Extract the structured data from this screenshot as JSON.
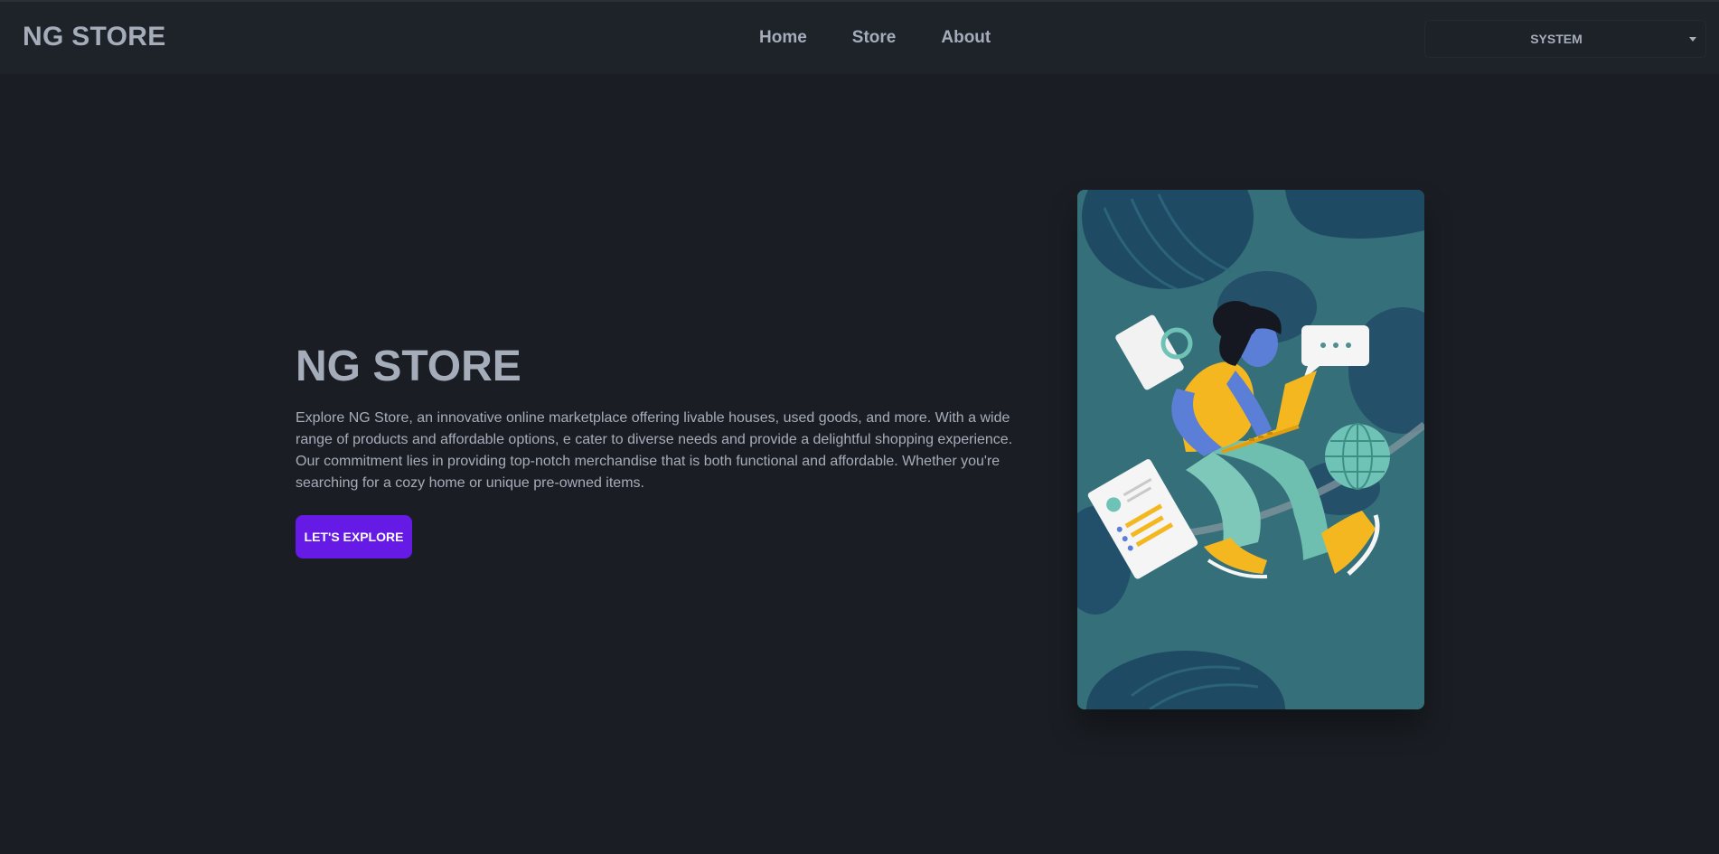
{
  "navbar": {
    "brand": "NG STORE",
    "links": [
      "Home",
      "Store",
      "About"
    ],
    "theme_select": {
      "value": "SYSTEM"
    }
  },
  "hero": {
    "title": "NG STORE",
    "description": "Explore NG Store, an innovative online marketplace offering livable houses, used goods, and more. With a wide range of products and affordable options, e cater to diverse needs and provide a delightful shopping experience. Our commitment lies in providing top-notch merchandise that is both functional and affordable. Whether you're searching for a cozy home or unique pre-owned items.",
    "cta_label": "LET'S EXPLORE",
    "image": {
      "alt": "woman-with-laptop-illustration"
    }
  },
  "colors": {
    "background": "#1a1e24",
    "navbar": "#1e232a",
    "text": "#a6adba",
    "primary": "#661ae6",
    "image_bg": "#35707a"
  }
}
